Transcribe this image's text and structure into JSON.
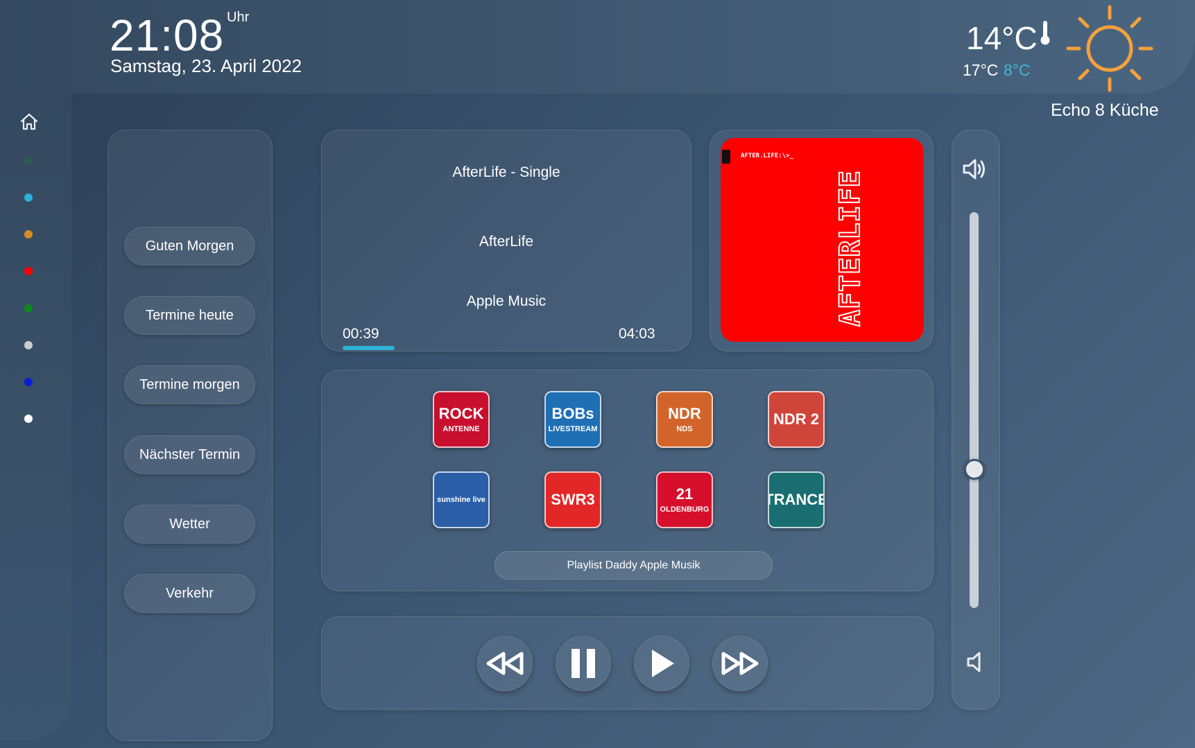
{
  "header": {
    "time": "21:08",
    "time_unit": "Uhr",
    "date": "Samstag, 23. April 2022"
  },
  "weather": {
    "temperature": "14°C",
    "high": "17°C",
    "low": "8°C",
    "icon": "sun-icon",
    "thermometer_icon": "thermometer-icon",
    "accent_color": "#f5a03c",
    "low_color": "#3fb7d8"
  },
  "device": {
    "name": "Echo 8 Küche"
  },
  "sidebar": {
    "home_icon": "home-icon",
    "dots": [
      {
        "color": "#2f5a4f"
      },
      {
        "color": "#2fb2d6"
      },
      {
        "color": "#d68c23"
      },
      {
        "color": "#ff0000"
      },
      {
        "color": "#0e8a1a"
      },
      {
        "color": "#c9ced3"
      },
      {
        "color": "#0a1dd8"
      },
      {
        "color": "#ffffff"
      }
    ]
  },
  "routines": [
    {
      "label": "Guten Morgen"
    },
    {
      "label": "Termine heute"
    },
    {
      "label": "Termine morgen"
    },
    {
      "label": "Nächster Termin"
    },
    {
      "label": "Wetter"
    },
    {
      "label": "Verkehr"
    }
  ],
  "now_playing": {
    "album": "AfterLife - Single",
    "title": "AfterLife",
    "source": "Apple Music",
    "elapsed": "00:39",
    "duration": "04:03",
    "progress": 0.16,
    "progress_color": "#2fb2d6"
  },
  "album_art": {
    "header_text": "AFTER.LIFE:\\>_",
    "cover_text": "AFTERLIFE",
    "background": "#ff0000"
  },
  "stations": [
    {
      "name": "ROCK",
      "sub": "ANTENNE",
      "bg": "#c8102e"
    },
    {
      "name": "BOBs",
      "sub": "LIVESTREAM",
      "bg": "#1f6fb5"
    },
    {
      "name": "NDR",
      "sub": "NDS",
      "bg": "#d2642a"
    },
    {
      "name": "NDR 2",
      "sub": "",
      "bg": "#d0453a"
    },
    {
      "name": "sunshine live",
      "sub": "",
      "bg": "#2a5fa8"
    },
    {
      "name": "SWR3",
      "sub": "",
      "bg": "#e22726"
    },
    {
      "name": "21",
      "sub": "OLDENBURG",
      "bg": "#d6102b"
    },
    {
      "name": "TRANCE",
      "sub": "",
      "bg": "#1a6e72"
    }
  ],
  "playlist": {
    "label": "Playlist Daddy Apple Musik"
  },
  "controls": {
    "rewind_icon": "rewind-icon",
    "pause_icon": "pause-icon",
    "play_icon": "play-icon",
    "forward_icon": "fast-forward-icon"
  },
  "volume": {
    "level": 0.35,
    "up_icon": "volume-up-icon",
    "down_icon": "volume-down-icon"
  }
}
